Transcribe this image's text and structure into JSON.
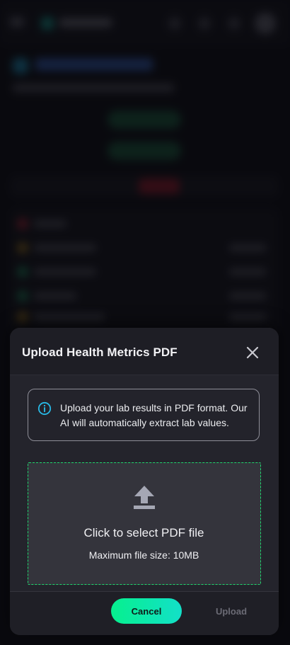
{
  "modal": {
    "title": "Upload Health Metrics PDF",
    "info_text": "Upload your lab results in PDF format. Our AI will automatically extract lab values.",
    "dropzone": {
      "title": "Click to select PDF file",
      "subtitle": "Maximum file size: 10MB"
    },
    "footer": {
      "cancel_label": "Cancel",
      "upload_label": "Upload",
      "upload_enabled": false
    }
  },
  "icons": {
    "close": "close-icon",
    "info": "info-circle-icon",
    "upload": "upload-arrow-icon"
  },
  "colors": {
    "accent_green": "#06f08e",
    "accent_teal": "#13e0c8",
    "dropzone_border": "#1fd86e",
    "info_icon": "#28b9e6",
    "modal_bg": "#24242c"
  }
}
